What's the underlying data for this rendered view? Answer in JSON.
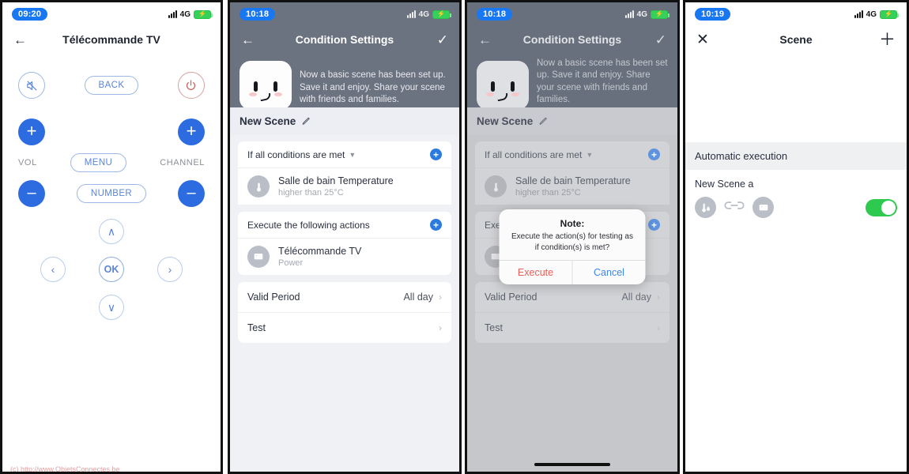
{
  "panels": {
    "remote": {
      "status": {
        "time": "09:20",
        "network": "4G"
      },
      "nav": {
        "back_icon": "arrow-left-icon",
        "title": "Télécommande TV"
      },
      "buttons": {
        "mute": "mute-icon",
        "back": "BACK",
        "power": "power-icon",
        "vol_up": "+",
        "vol_label": "VOL",
        "vol_down": "–",
        "menu": "MENU",
        "number": "NUMBER",
        "channel_up": "+",
        "channel_label": "CHANNEL",
        "channel_down": "–",
        "up": "∧",
        "left": "‹",
        "ok": "OK",
        "right": "›",
        "down": "∨"
      },
      "watermark": "(c) http://www.ObjetsConnectes.be"
    },
    "condition": {
      "status": {
        "time": "10:18",
        "network": "4G"
      },
      "nav": {
        "back_icon": "arrow-left-icon",
        "title": "Condition Settings",
        "confirm_icon": "check-icon"
      },
      "blurb": "Now a basic scene has been set up. Save it and enjoy. Share your scene with friends and families.",
      "scene_name": "New Scene",
      "edit_icon": "pencil-icon",
      "conditions": {
        "header": "If all conditions are met",
        "add_label": "+",
        "items": [
          {
            "icon": "thermometer-icon",
            "title": "Salle de bain Temperature",
            "sub": "higher than 25°C"
          }
        ]
      },
      "actions": {
        "header": "Execute the following actions",
        "add_label": "+",
        "items": [
          {
            "icon": "tv-remote-icon",
            "title": "Télécommande TV",
            "sub": "Power"
          }
        ]
      },
      "settings": [
        {
          "label": "Valid Period",
          "value": "All day",
          "chev": "›"
        },
        {
          "label": "Test",
          "value": "",
          "chev": "›"
        }
      ]
    },
    "condition_dialog": {
      "status": {
        "time": "10:18",
        "network": "4G"
      },
      "nav": {
        "back_icon": "arrow-left-icon",
        "title": "Condition Settings",
        "confirm_icon": "check-icon"
      },
      "blurb": "Now a basic scene has been set up. Save it and enjoy. Share your scene with friends and families.",
      "scene_name": "New Scene",
      "edit_icon": "pencil-icon",
      "conditions": {
        "header": "If all conditions are met",
        "add_label": "+",
        "items": [
          {
            "icon": "thermometer-icon",
            "title": "Salle de bain Temperature",
            "sub": "higher than 25°C"
          }
        ]
      },
      "actions": {
        "header": "Exe",
        "add_label": "+"
      },
      "settings": [
        {
          "label": "Valid Period",
          "value": "All day",
          "chev": "›"
        },
        {
          "label": "Test",
          "value": "",
          "chev": "›"
        }
      ],
      "dialog": {
        "title": "Note:",
        "message": "Execute the action(s) for testing as if condition(s) is met?",
        "execute_label": "Execute",
        "cancel_label": "Cancel",
        "execute_color": "#e8605a",
        "cancel_color": "#3b86f0"
      }
    },
    "scene": {
      "status": {
        "time": "10:19",
        "network": "4G"
      },
      "nav": {
        "close_icon": "close-icon",
        "title": "Scene",
        "add_icon": "plus-icon"
      },
      "section_header": "Automatic execution",
      "item": {
        "name": "New Scene a",
        "icons": [
          "thermometer-humidity-icon",
          "link-icon",
          "tv-remote-icon"
        ],
        "toggle_on": true,
        "toggle_color": "#2ec94f"
      }
    }
  }
}
